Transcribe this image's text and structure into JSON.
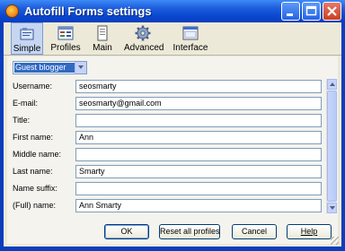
{
  "window": {
    "title": "Autofill Forms settings"
  },
  "toolbar": {
    "items": [
      {
        "label": "Simple",
        "icon": "simple-icon"
      },
      {
        "label": "Profiles",
        "icon": "profiles-icon"
      },
      {
        "label": "Main",
        "icon": "main-icon"
      },
      {
        "label": "Advanced",
        "icon": "advanced-gear-icon"
      },
      {
        "label": "Interface",
        "icon": "interface-icon"
      }
    ]
  },
  "profile": {
    "selected": "Guest blogger"
  },
  "fields": [
    {
      "label": "Username:",
      "value": "seosmarty"
    },
    {
      "label": "E-mail:",
      "value": "seosmarty@gmail.com"
    },
    {
      "label": "Title:",
      "value": ""
    },
    {
      "label": "First name:",
      "value": "Ann"
    },
    {
      "label": "Middle name:",
      "value": ""
    },
    {
      "label": "Last name:",
      "value": "Smarty"
    },
    {
      "label": "Name suffix:",
      "value": ""
    },
    {
      "label": "(Full) name:",
      "value": "Ann Smarty"
    }
  ],
  "buttons": {
    "ok": "OK",
    "reset": "Reset all profiles",
    "cancel": "Cancel",
    "help": "Help"
  },
  "colors": {
    "titlebar": "#0a47d0",
    "selection": "#316ac5",
    "dialog_bg": "#ece9d8"
  }
}
